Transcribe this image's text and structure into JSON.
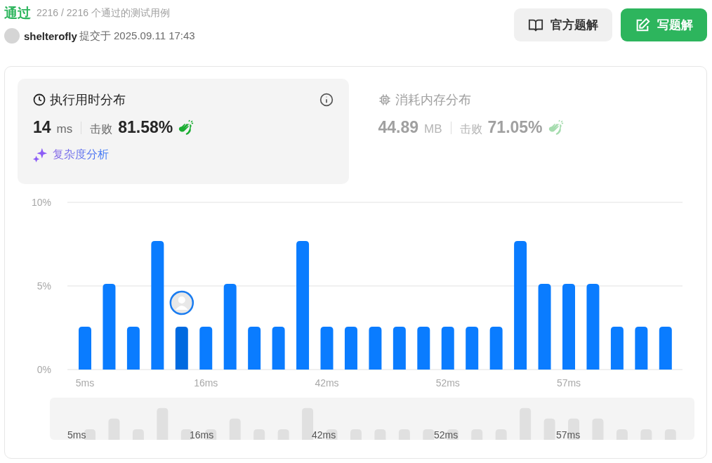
{
  "status": {
    "label": "通过",
    "summary": "2216 / 2216 个通过的测试用例"
  },
  "submission": {
    "user": "shelterofly",
    "submitted_at": "提交于 2025.09.11 17:43"
  },
  "buttons": [
    {
      "kind": "solution",
      "label": "官方题解"
    },
    {
      "kind": "write",
      "label": "写题解"
    }
  ],
  "stats": [
    {
      "kind": "runtime",
      "title": "执行用时分布",
      "selected": true,
      "value": "14",
      "unit": "ms",
      "beats_label": "击败",
      "beats": "81.58%",
      "link": "复杂度分析"
    },
    {
      "kind": "memory",
      "title": "消耗内存分布",
      "selected": false,
      "value": "44.89",
      "unit": "MB",
      "beats_label": "击败",
      "beats": "71.05%"
    }
  ],
  "chart_data": {
    "type": "bar",
    "values": [
      2.56,
      5.13,
      2.56,
      7.69,
      2.56,
      2.56,
      5.13,
      2.56,
      2.56,
      7.69,
      2.56,
      2.56,
      2.56,
      2.56,
      2.56,
      2.56,
      2.56,
      2.56,
      7.69,
      5.13,
      5.13,
      5.13,
      2.56,
      2.56,
      2.56
    ],
    "ylim": [
      0,
      10
    ],
    "yticks": [
      {
        "value": 0,
        "label": "0%"
      },
      {
        "value": 5,
        "label": "5%"
      },
      {
        "value": 10,
        "label": "10%"
      }
    ]
  },
  "bars": [
    {
      "selected": false
    },
    {
      "selected": false
    },
    {
      "selected": false
    },
    {
      "selected": false
    },
    {
      "selected": true
    },
    {
      "selected": false
    },
    {
      "selected": false
    },
    {
      "selected": false
    },
    {
      "selected": false
    },
    {
      "selected": false
    },
    {
      "selected": false
    },
    {
      "selected": false
    },
    {
      "selected": false
    },
    {
      "selected": false
    },
    {
      "selected": false
    },
    {
      "selected": false
    },
    {
      "selected": false
    },
    {
      "selected": false
    },
    {
      "selected": false
    },
    {
      "selected": false
    },
    {
      "selected": false
    },
    {
      "selected": false
    },
    {
      "selected": false
    },
    {
      "selected": false
    },
    {
      "selected": false
    }
  ],
  "x_axis_labels": [
    "5ms",
    "16ms",
    "42ms",
    "52ms",
    "57ms"
  ],
  "navigator": {
    "labels": [
      "5ms",
      "16ms",
      "42ms",
      "52ms",
      "57ms"
    ]
  }
}
